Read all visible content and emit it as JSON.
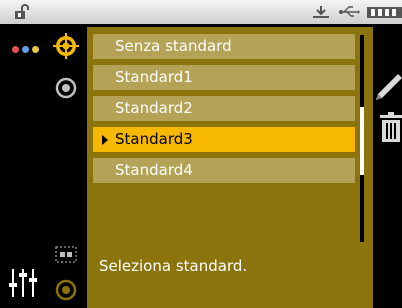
{
  "statusbar": {
    "icons": [
      "lock-open-icon",
      "usb-download-icon",
      "usb-icon",
      "battery-icon"
    ]
  },
  "rail": {
    "dots_colors": [
      "#e94f4f",
      "#5ca4e8",
      "#e6c94a"
    ],
    "icons": [
      "color-dots-icon",
      "sliders-icon"
    ]
  },
  "strip": {
    "icons": [
      "target-crosshair-icon",
      "ring-icon",
      "screen-subicon",
      "ring-ghost-icon"
    ],
    "accent": "#f6b800"
  },
  "list": {
    "items": [
      {
        "label": "Senza standard",
        "selected": false
      },
      {
        "label": "Standard1",
        "selected": false
      },
      {
        "label": "Standard2",
        "selected": false
      },
      {
        "label": "Standard3",
        "selected": true
      },
      {
        "label": "Standard4",
        "selected": false
      }
    ],
    "scroll_position": 0.52
  },
  "hint": "Seleziona standard.",
  "side_actions": [
    "pencil-icon",
    "trash-icon"
  ],
  "colors": {
    "panel": "#8c740c",
    "item": "#b4a257",
    "selected": "#f6b800"
  }
}
